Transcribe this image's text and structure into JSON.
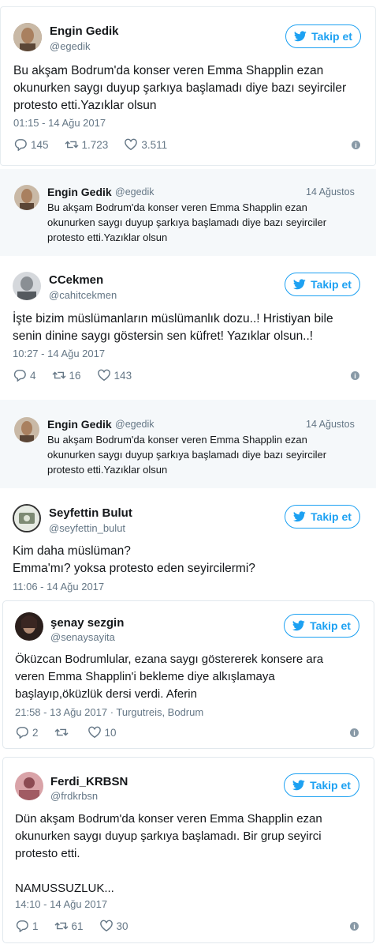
{
  "tweets": [
    {
      "name": "Engin Gedik",
      "handle": "@egedik",
      "follow_label": "Takip et",
      "text": [
        "Bu akşam Bodrum'da konser veren Emma Shapplin ezan",
        "okunurken saygı duyup şarkıya başlamadı diye bazı seyirciler",
        "protesto etti.Yazıklar olsun"
      ],
      "date": "01:15 - 14 Ağu 2017",
      "replies": "145",
      "retweets": "1.723",
      "likes": "3.511",
      "avatar_color": "#8a6a4f"
    },
    {
      "name": "CCekmen",
      "handle": "@cahitcekmen",
      "follow_label": "Takip et",
      "text": [
        "İşte bizim müslümanların müslümanlık dozu..! Hristiyan bile",
        "senin dinine saygı göstersin sen küfret! Yazıklar olsun..!"
      ],
      "date": "10:27 - 14 Ağu 2017",
      "replies": "4",
      "retweets": "16",
      "likes": "143",
      "avatar_color": "#9aa0a6"
    },
    {
      "name": "Seyfettin Bulut",
      "handle": "@seyfettin_bulut",
      "follow_label": "Takip et",
      "text": [
        "Kim daha müslüman?",
        "Emma'mı? yoksa protesto eden seyircilermi?"
      ],
      "date": "11:06 - 14 Ağu 2017",
      "avatar_color": "#6f7a6a"
    },
    {
      "name": "şenay sezgin",
      "handle": "@senaysayita",
      "follow_label": "Takip et",
      "text": [
        "Öküzcan Bodrumlular, ezana saygı göstererek konsere ara",
        "veren Emma Shapplin'i bekleme diye alkışlamaya",
        "başlayıp,öküzlük dersi verdi. Aferin"
      ],
      "date": "21:58 - 13 Ağu 2017 · Turgutreis, Bodrum",
      "replies": "2",
      "retweets": "",
      "likes": "10",
      "avatar_color": "#4a2f2a"
    },
    {
      "name": "Ferdi_KRBSN",
      "handle": "@frdkrbsn",
      "follow_label": "Takip et",
      "text": [
        "Dün akşam Bodrum'da konser veren Emma Shapplin ezan",
        "okunurken saygı duyup şarkıya başlamadı. Bir grup seyirci",
        "protesto etti.",
        "",
        "NAMUSSUZLUK..."
      ],
      "date": "14:10 - 14 Ağu 2017",
      "replies": "1",
      "retweets": "61",
      "likes": "30",
      "avatar_color": "#b0707a"
    }
  ],
  "quotes": [
    {
      "name": "Engin Gedik",
      "handle": "@egedik",
      "date": "14 Ağustos",
      "text": [
        "Bu akşam Bodrum'da konser veren Emma Shapplin ezan",
        "okunurken saygı duyup şarkıya başlamadı diye bazı seyirciler",
        "protesto etti.Yazıklar olsun"
      ]
    },
    {
      "name": "Engin Gedik",
      "handle": "@egedik",
      "date": "14 Ağustos",
      "text": [
        "Bu akşam Bodrum'da konser veren Emma Shapplin ezan",
        "okunurken saygı duyup şarkıya başlamadı diye bazı seyirciler",
        "protesto etti.Yazıklar olsun"
      ]
    }
  ],
  "colors": {
    "accent": "#1da1f2",
    "muted": "#657786",
    "quote_bg": "#f5f8fa"
  }
}
